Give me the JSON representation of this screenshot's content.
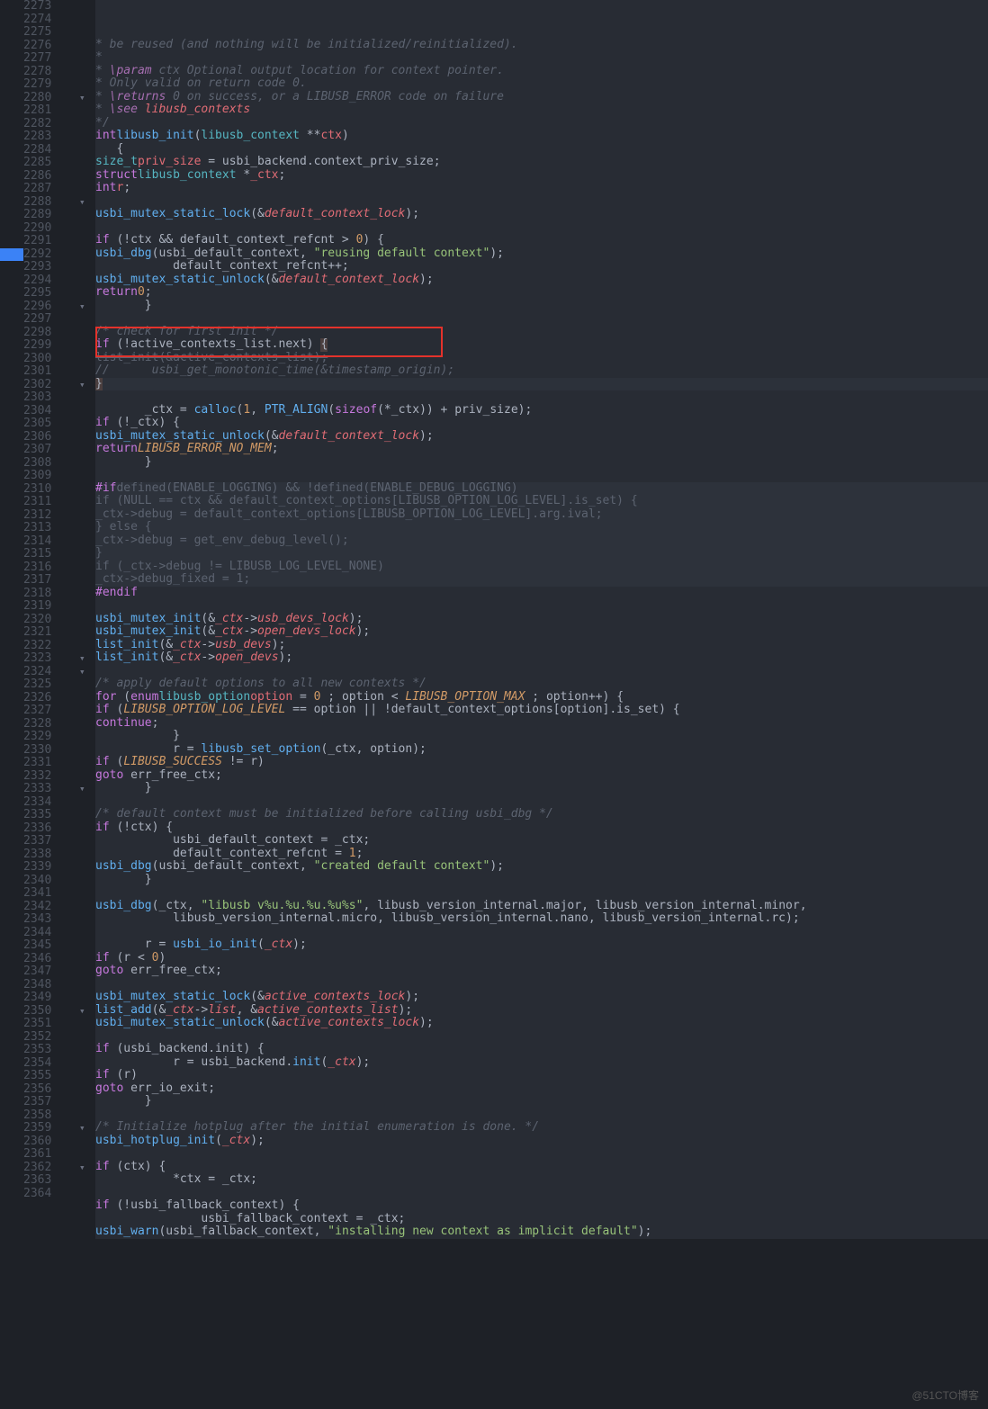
{
  "watermark": "@51CTO博客",
  "lines": [
    {
      "n": 2273,
      "f": "",
      "cls": "",
      "html": "    <span class='c-comment'>* be reused (and nothing will be initialized/reinitialized).</span>"
    },
    {
      "n": 2274,
      "f": "",
      "cls": "",
      "html": "    <span class='c-comment'>*</span>"
    },
    {
      "n": 2275,
      "f": "",
      "cls": "",
      "html": "    <span class='c-comment'>* <span class='c-doctag-kw'>\\param</span> ctx Optional output location for context pointer.</span>"
    },
    {
      "n": 2276,
      "f": "",
      "cls": "",
      "html": "    <span class='c-comment'>* Only valid on return code 0.</span>"
    },
    {
      "n": 2277,
      "f": "",
      "cls": "",
      "html": "    <span class='c-comment'>* <span class='c-doctag-kw'>\\returns</span> 0 on success, or a LIBUSB_ERROR code on failure</span>"
    },
    {
      "n": 2278,
      "f": "",
      "cls": "",
      "html": "    <span class='c-comment'>* <span class='c-doctag-kw'>\\see</span> <span class='c-ident'>libusb_contexts</span></span>"
    },
    {
      "n": 2279,
      "f": "",
      "cls": "",
      "html": "    <span class='c-comment'>*/</span>"
    },
    {
      "n": 2280,
      "f": "▾",
      "cls": "",
      "html": "   <span class='c-kw'>int</span>  <span class='c-func'>libusb_init</span>(<span class='c-type2'>libusb_context</span> **<span class='c-ident'>ctx</span>)"
    },
    {
      "n": 2281,
      "f": "",
      "cls": "",
      "html": "   {"
    },
    {
      "n": 2282,
      "f": "",
      "cls": "",
      "html": "       <span class='c-type2'>size_t</span> <span class='c-ident'>priv_size</span> = usbi_backend.context_priv_size;"
    },
    {
      "n": 2283,
      "f": "",
      "cls": "",
      "html": "       <span class='c-kw'>struct</span> <span class='c-type2'>libusb_context</span> *<span class='c-ident'>_ctx</span>;"
    },
    {
      "n": 2284,
      "f": "",
      "cls": "",
      "html": "       <span class='c-kw'>int</span> <span class='c-ident'>r</span>;"
    },
    {
      "n": 2285,
      "f": "",
      "cls": "",
      "html": ""
    },
    {
      "n": 2286,
      "f": "",
      "cls": "",
      "html": "       <span class='c-func'>usbi_mutex_static_lock</span>(&amp;<span class='c-ident-i'>default_context_lock</span>);"
    },
    {
      "n": 2287,
      "f": "",
      "cls": "",
      "html": ""
    },
    {
      "n": 2288,
      "f": "▾",
      "cls": "",
      "html": "       <span class='c-kw'>if</span> (!ctx &amp;&amp; default_context_refcnt &gt; <span class='c-num'>0</span>) {"
    },
    {
      "n": 2289,
      "f": "",
      "cls": "",
      "html": "           <span class='c-func'>usbi_dbg</span>(usbi_default_context, <span class='c-str'>\"reusing default context\"</span>);"
    },
    {
      "n": 2290,
      "f": "",
      "cls": "",
      "html": "           default_context_refcnt++;"
    },
    {
      "n": 2291,
      "f": "",
      "cls": "",
      "html": "           <span class='c-func'>usbi_mutex_static_unlock</span>(&amp;<span class='c-ident-i'>default_context_lock</span>);"
    },
    {
      "n": 2292,
      "f": "",
      "cls": "",
      "marker": "blue",
      "html": "           <span class='c-kw'>return</span> <span class='c-num'>0</span>;"
    },
    {
      "n": 2293,
      "f": "",
      "cls": "",
      "html": "       }"
    },
    {
      "n": 2294,
      "f": "",
      "cls": "",
      "html": ""
    },
    {
      "n": 2295,
      "f": "",
      "cls": "",
      "html": "       <span class='c-comment'>/* check for first init */</span>"
    },
    {
      "n": 2296,
      "f": "▾",
      "cls": "",
      "html": "       <span class='c-kw'>if</span> (!active_contexts_list.next) <span style='background:#4b3f3f'>{</span>"
    },
    {
      "n": 2297,
      "f": "",
      "cls": "",
      "html": "           <span class='c-dim' style='text-decoration:line-through'>list_init(&amp;active_contexts_list);</span>"
    },
    {
      "n": 2298,
      "f": "",
      "cls": "",
      "html": "   <span class='c-comment'>//      usbi_get_monotonic_time(&amp;timestamp_origin);</span>"
    },
    {
      "n": 2299,
      "f": "",
      "cls": "active",
      "html": "       <span style='background:#4b3f3f'>}</span>"
    },
    {
      "n": 2300,
      "f": "",
      "cls": "",
      "html": ""
    },
    {
      "n": 2301,
      "f": "",
      "cls": "",
      "html": "       _ctx = <span class='c-func'>calloc</span>(<span class='c-num'>1</span>, <span class='c-func'>PTR_ALIGN</span>(<span class='c-kw'>sizeof</span>(*_ctx)) + priv_size);"
    },
    {
      "n": 2302,
      "f": "▾",
      "cls": "",
      "html": "       <span class='c-kw'>if</span> (!_ctx) {"
    },
    {
      "n": 2303,
      "f": "",
      "cls": "",
      "html": "           <span class='c-func'>usbi_mutex_static_unlock</span>(&amp;<span class='c-ident-i'>default_context_lock</span>);"
    },
    {
      "n": 2304,
      "f": "",
      "cls": "",
      "html": "           <span class='c-kw'>return</span> <span class='c-enumval'>LIBUSB_ERROR_NO_MEM</span>;"
    },
    {
      "n": 2305,
      "f": "",
      "cls": "",
      "html": "       }"
    },
    {
      "n": 2306,
      "f": "",
      "cls": "",
      "html": ""
    },
    {
      "n": 2307,
      "f": "",
      "cls": "dim",
      "html": "   <span class='c-pp'>#if</span> <span class='c-dim'>defined(ENABLE_LOGGING) &amp;&amp; !defined(ENABLE_DEBUG_LOGGING)</span>"
    },
    {
      "n": 2308,
      "f": "",
      "cls": "dim",
      "html": "       <span class='c-dim'>if (NULL == ctx &amp;&amp; default_context_options[LIBUSB_OPTION_LOG_LEVEL].is_set) {</span>"
    },
    {
      "n": 2309,
      "f": "",
      "cls": "dim",
      "html": "           <span class='c-dim'>_ctx-&gt;debug = default_context_options[LIBUSB_OPTION_LOG_LEVEL].arg.ival;</span>"
    },
    {
      "n": 2310,
      "f": "",
      "cls": "dim",
      "html": "       <span class='c-dim'>} else {</span>"
    },
    {
      "n": 2311,
      "f": "",
      "cls": "dim",
      "html": "           <span class='c-dim'>_ctx-&gt;debug = get_env_debug_level();</span>"
    },
    {
      "n": 2312,
      "f": "",
      "cls": "dim",
      "html": "       <span class='c-dim'>}</span>"
    },
    {
      "n": 2313,
      "f": "",
      "cls": "dim",
      "html": "       <span class='c-dim'>if (_ctx-&gt;debug != LIBUSB_LOG_LEVEL_NONE)</span>"
    },
    {
      "n": 2314,
      "f": "",
      "cls": "dim",
      "html": "           <span class='c-dim'>_ctx-&gt;debug_fixed = 1;</span>"
    },
    {
      "n": 2315,
      "f": "",
      "cls": "",
      "html": "   <span class='c-pp'>#endif</span>"
    },
    {
      "n": 2316,
      "f": "",
      "cls": "",
      "html": ""
    },
    {
      "n": 2317,
      "f": "",
      "cls": "",
      "html": "       <span class='c-func'>usbi_mutex_init</span>(&amp;<span class='c-ident-i'>_ctx</span>-&gt;<span class='c-ident-i'>usb_devs_lock</span>);"
    },
    {
      "n": 2318,
      "f": "",
      "cls": "",
      "html": "       <span class='c-func'>usbi_mutex_init</span>(&amp;<span class='c-ident-i'>_ctx</span>-&gt;<span class='c-ident-i'>open_devs_lock</span>);"
    },
    {
      "n": 2319,
      "f": "",
      "cls": "",
      "html": "       <span class='c-func'>list_init</span>(&amp;<span class='c-ident-i'>_ctx</span>-&gt;<span class='c-ident-i'>usb_devs</span>);"
    },
    {
      "n": 2320,
      "f": "",
      "cls": "",
      "html": "       <span class='c-func'>list_init</span>(&amp;<span class='c-ident-i'>_ctx</span>-&gt;<span class='c-ident-i'>open_devs</span>);"
    },
    {
      "n": 2321,
      "f": "",
      "cls": "",
      "html": ""
    },
    {
      "n": 2322,
      "f": "",
      "cls": "",
      "html": "       <span class='c-comment'>/* apply default options to all new contexts */</span>"
    },
    {
      "n": 2323,
      "f": "▾",
      "cls": "",
      "html": "       <span class='c-kw'>for</span> (<span class='c-kw'>enum</span> <span class='c-type2'>libusb_option</span> <span class='c-ident'>option</span> = <span class='c-num'>0</span> ; option &lt; <span class='c-enumval'>LIBUSB_OPTION_MAX</span> ; option++) {"
    },
    {
      "n": 2324,
      "f": "▾",
      "cls": "",
      "html": "           <span class='c-kw'>if</span> (<span class='c-enumval'>LIBUSB_OPTION_LOG_LEVEL</span> == option || !default_context_options[option].is_set) {"
    },
    {
      "n": 2325,
      "f": "",
      "cls": "",
      "html": "               <span class='c-kw'>continue</span>;"
    },
    {
      "n": 2326,
      "f": "",
      "cls": "",
      "html": "           }"
    },
    {
      "n": 2327,
      "f": "",
      "cls": "",
      "html": "           r = <span class='c-func'>libusb_set_option</span>(_ctx, option);"
    },
    {
      "n": 2328,
      "f": "",
      "cls": "",
      "html": "           <span class='c-kw'>if</span> (<span class='c-enumval'>LIBUSB_SUCCESS</span> != r)"
    },
    {
      "n": 2329,
      "f": "",
      "cls": "",
      "html": "               <span class='c-kw'>goto</span> err_free_ctx;"
    },
    {
      "n": 2330,
      "f": "",
      "cls": "",
      "html": "       }"
    },
    {
      "n": 2331,
      "f": "",
      "cls": "",
      "html": ""
    },
    {
      "n": 2332,
      "f": "",
      "cls": "",
      "html": "       <span class='c-comment'>/* default context must be initialized before calling usbi_dbg */</span>"
    },
    {
      "n": 2333,
      "f": "▾",
      "cls": "",
      "html": "       <span class='c-kw'>if</span> (!ctx) {"
    },
    {
      "n": 2334,
      "f": "",
      "cls": "",
      "html": "           usbi_default_context = _ctx;"
    },
    {
      "n": 2335,
      "f": "",
      "cls": "",
      "html": "           default_context_refcnt = <span class='c-num'>1</span>;"
    },
    {
      "n": 2336,
      "f": "",
      "cls": "",
      "html": "           <span class='c-func'>usbi_dbg</span>(usbi_default_context, <span class='c-str'>\"created default context\"</span>);"
    },
    {
      "n": 2337,
      "f": "",
      "cls": "",
      "html": "       }"
    },
    {
      "n": 2338,
      "f": "",
      "cls": "",
      "html": ""
    },
    {
      "n": 2339,
      "f": "",
      "cls": "",
      "html": "       <span class='c-func'>usbi_dbg</span>(_ctx, <span class='c-str'>\"libusb v%u.%u.%u.%u%s\"</span>, libusb_version_internal.major, libusb_version_internal.minor,"
    },
    {
      "n": 2340,
      "f": "",
      "cls": "",
      "html": "           libusb_version_internal.micro, libusb_version_internal.nano, libusb_version_internal.rc);"
    },
    {
      "n": 2341,
      "f": "",
      "cls": "",
      "html": ""
    },
    {
      "n": 2342,
      "f": "",
      "cls": "",
      "html": "       r = <span class='c-func'>usbi_io_init</span>(<span class='c-ident-i'>_ctx</span>);"
    },
    {
      "n": 2343,
      "f": "",
      "cls": "",
      "html": "       <span class='c-kw'>if</span> (r &lt; <span class='c-num'>0</span>)"
    },
    {
      "n": 2344,
      "f": "",
      "cls": "",
      "html": "           <span class='c-kw'>goto</span> err_free_ctx;"
    },
    {
      "n": 2345,
      "f": "",
      "cls": "",
      "html": ""
    },
    {
      "n": 2346,
      "f": "",
      "cls": "",
      "html": "       <span class='c-func'>usbi_mutex_static_lock</span>(&amp;<span class='c-ident-i'>active_contexts_lock</span>);"
    },
    {
      "n": 2347,
      "f": "",
      "cls": "",
      "html": "       <span class='c-func'>list_add</span>(&amp;<span class='c-ident-i'>_ctx</span>-&gt;<span class='c-ident-i'>list</span>, &amp;<span class='c-ident-i'>active_contexts_list</span>);"
    },
    {
      "n": 2348,
      "f": "",
      "cls": "",
      "html": "       <span class='c-func'>usbi_mutex_static_unlock</span>(&amp;<span class='c-ident-i'>active_contexts_lock</span>);"
    },
    {
      "n": 2349,
      "f": "",
      "cls": "",
      "html": ""
    },
    {
      "n": 2350,
      "f": "▾",
      "cls": "",
      "html": "       <span class='c-kw'>if</span> (usbi_backend.init) {"
    },
    {
      "n": 2351,
      "f": "",
      "cls": "",
      "html": "           r = usbi_backend.<span class='c-func'>init</span>(<span class='c-ident-i'>_ctx</span>);"
    },
    {
      "n": 2352,
      "f": "",
      "cls": "",
      "html": "           <span class='c-kw'>if</span> (r)"
    },
    {
      "n": 2353,
      "f": "",
      "cls": "",
      "html": "               <span class='c-kw'>goto</span> err_io_exit;"
    },
    {
      "n": 2354,
      "f": "",
      "cls": "",
      "html": "       }"
    },
    {
      "n": 2355,
      "f": "",
      "cls": "",
      "html": ""
    },
    {
      "n": 2356,
      "f": "",
      "cls": "",
      "html": "       <span class='c-comment'>/* Initialize hotplug after the initial enumeration is done. */</span>"
    },
    {
      "n": 2357,
      "f": "",
      "cls": "",
      "html": "       <span class='c-func'>usbi_hotplug_init</span>(<span class='c-ident-i'>_ctx</span>);"
    },
    {
      "n": 2358,
      "f": "",
      "cls": "",
      "html": ""
    },
    {
      "n": 2359,
      "f": "▾",
      "cls": "",
      "html": "       <span class='c-kw'>if</span> (ctx) {"
    },
    {
      "n": 2360,
      "f": "",
      "cls": "",
      "html": "           *ctx = _ctx;"
    },
    {
      "n": 2361,
      "f": "",
      "cls": "",
      "html": ""
    },
    {
      "n": 2362,
      "f": "▾",
      "cls": "",
      "html": "           <span class='c-kw'>if</span> (!usbi_fallback_context) {"
    },
    {
      "n": 2363,
      "f": "",
      "cls": "",
      "html": "               usbi_fallback_context = _ctx;"
    },
    {
      "n": 2364,
      "f": "",
      "cls": "",
      "html": "               <span class='c-func'>usbi_warn</span>(usbi_fallback_context, <span class='c-str'>\"installing new context as implicit default\"</span>);"
    }
  ]
}
